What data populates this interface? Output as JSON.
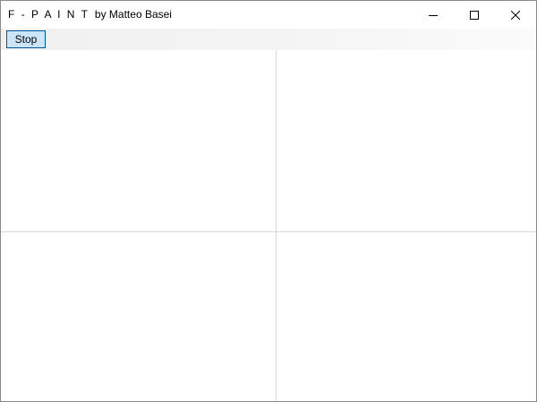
{
  "window": {
    "app_name": "F - P A I N T",
    "author": "by Matteo Basei"
  },
  "titlebar_buttons": {
    "minimize_icon": "minimize-icon",
    "maximize_icon": "maximize-icon",
    "close_icon": "close-icon"
  },
  "toolbar": {
    "stop_label": "Stop",
    "stop_color": "#cce4f7",
    "stop_border_color": "#005499"
  },
  "canvas": {
    "pane_count": 4,
    "divider_color": "#d8d8d8"
  }
}
